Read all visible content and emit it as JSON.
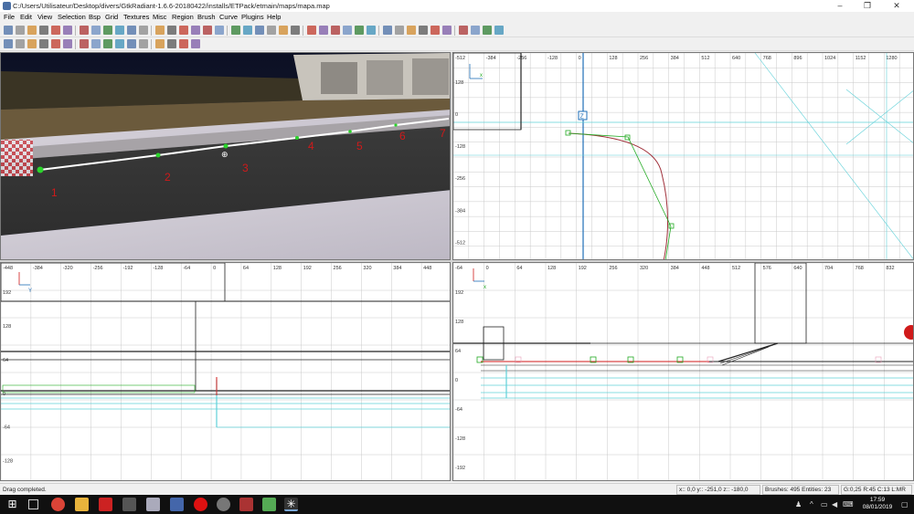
{
  "window": {
    "title": "C:/Users/Utilisateur/Desktop/divers/GtkRadiant-1.6.6-20180422/installs/ETPack/etmain/maps/mapa.map",
    "controls": [
      "–",
      "❐",
      "✕"
    ]
  },
  "menu": [
    "File",
    "Edit",
    "View",
    "Selection",
    "Bsp",
    "Grid",
    "Textures",
    "Misc",
    "Region",
    "Brush",
    "Curve",
    "Plugins",
    "Help"
  ],
  "camera": {
    "point_labels": [
      "1",
      "2",
      "3",
      "4",
      "5",
      "6",
      "7"
    ]
  },
  "top_view": {
    "x_ticks": [
      "-512",
      "-384",
      "-256",
      "-128",
      "0",
      "128",
      "256",
      "384",
      "512",
      "640",
      "768",
      "896",
      "1024",
      "1152",
      "1280"
    ],
    "y_ticks": [
      "128",
      "0",
      "-128",
      "-256",
      "-384",
      "-512"
    ],
    "axis_label": "x",
    "box_label": "Z"
  },
  "side_view": {
    "x_ticks": [
      "-448",
      "-384",
      "-320",
      "-256",
      "-192",
      "-128",
      "-64",
      "0",
      "64",
      "128",
      "192",
      "256",
      "320",
      "384",
      "448"
    ],
    "y_ticks": [
      "192",
      "128",
      "64",
      "0",
      "-64",
      "-128"
    ],
    "axis_label": "Y"
  },
  "front_view": {
    "x_ticks": [
      "-64",
      "0",
      "64",
      "128",
      "192",
      "256",
      "320",
      "384",
      "448",
      "512",
      "576",
      "640",
      "704",
      "768",
      "832"
    ],
    "y_ticks": [
      "192",
      "128",
      "64",
      "0",
      "-64",
      "-128",
      "-192"
    ],
    "axis_label": "x"
  },
  "status": {
    "message": "Drag completed.",
    "coords": "x:: 0,0  y:: -251,0  z:: -180,0",
    "counts": "Brushes: 495 Entities: 23",
    "grid": "G:0,25 R:45 C:13 L:MR"
  },
  "taskbar": {
    "time": "17:59",
    "date": "08/01/2019"
  },
  "colors": {
    "accent": "#3a7bd5",
    "grid_line": "#c8c8c8",
    "axis_blue": "#1f6fb8",
    "cyan": "#5fd0d8",
    "curve_red": "#a0303a",
    "handle_green": "#22aa22"
  }
}
